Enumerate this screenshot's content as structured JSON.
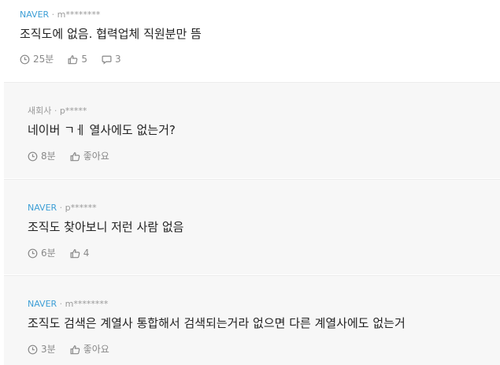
{
  "comments": [
    {
      "company": "NAVER",
      "separator": "·",
      "user": "m********",
      "text": "조직도에 없음. 협력업체 직원분만 뜸",
      "time": "25분",
      "likes": "5",
      "replies": "3"
    },
    {
      "company": "새회사",
      "separator": "·",
      "user": "p*****",
      "text": "네이버 ㄱㅔ 열사에도 없는거?",
      "time": "8분",
      "likes": "좋아요"
    },
    {
      "company": "NAVER",
      "separator": "·",
      "user": "p******",
      "text": "조직도 찾아보니 저런 사람 없음",
      "time": "6분",
      "likes": "4"
    },
    {
      "company": "NAVER",
      "separator": "·",
      "user": "m********",
      "text": "조직도 검색은 계열사 통합해서 검색되는거라 없으면 다른 계열사에도 없는거",
      "time": "3분",
      "likes": "좋아요"
    }
  ],
  "colors": {
    "naver_company": "#3e9fd6",
    "reply_background": "#f7f7f7",
    "body_text": "#222222",
    "meta_text": "#999999"
  },
  "icons": {
    "time": "clock-icon",
    "like": "thumbs-up-icon",
    "reply": "speech-bubble-icon"
  }
}
